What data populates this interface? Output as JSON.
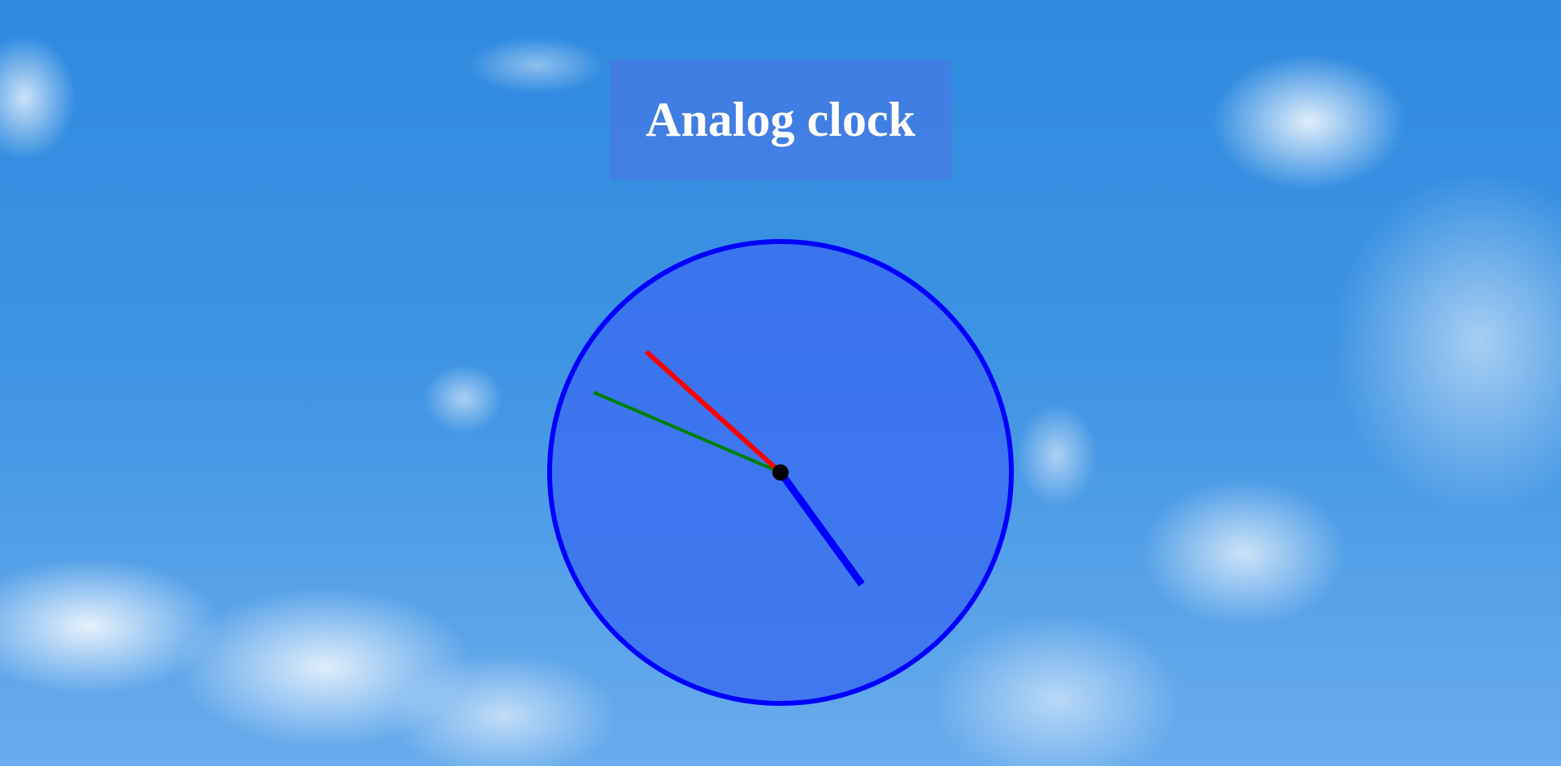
{
  "header": {
    "title": "Analog clock"
  },
  "clock": {
    "time": {
      "hour": 4,
      "minute": 48,
      "second": 52
    },
    "colors": {
      "face": "#3a6ef0",
      "rim": "#0000ff",
      "hour_hand": "#0000ff",
      "minute_hand": "#008000",
      "second_hand": "#ff0000",
      "center_dot": "#000000"
    }
  }
}
